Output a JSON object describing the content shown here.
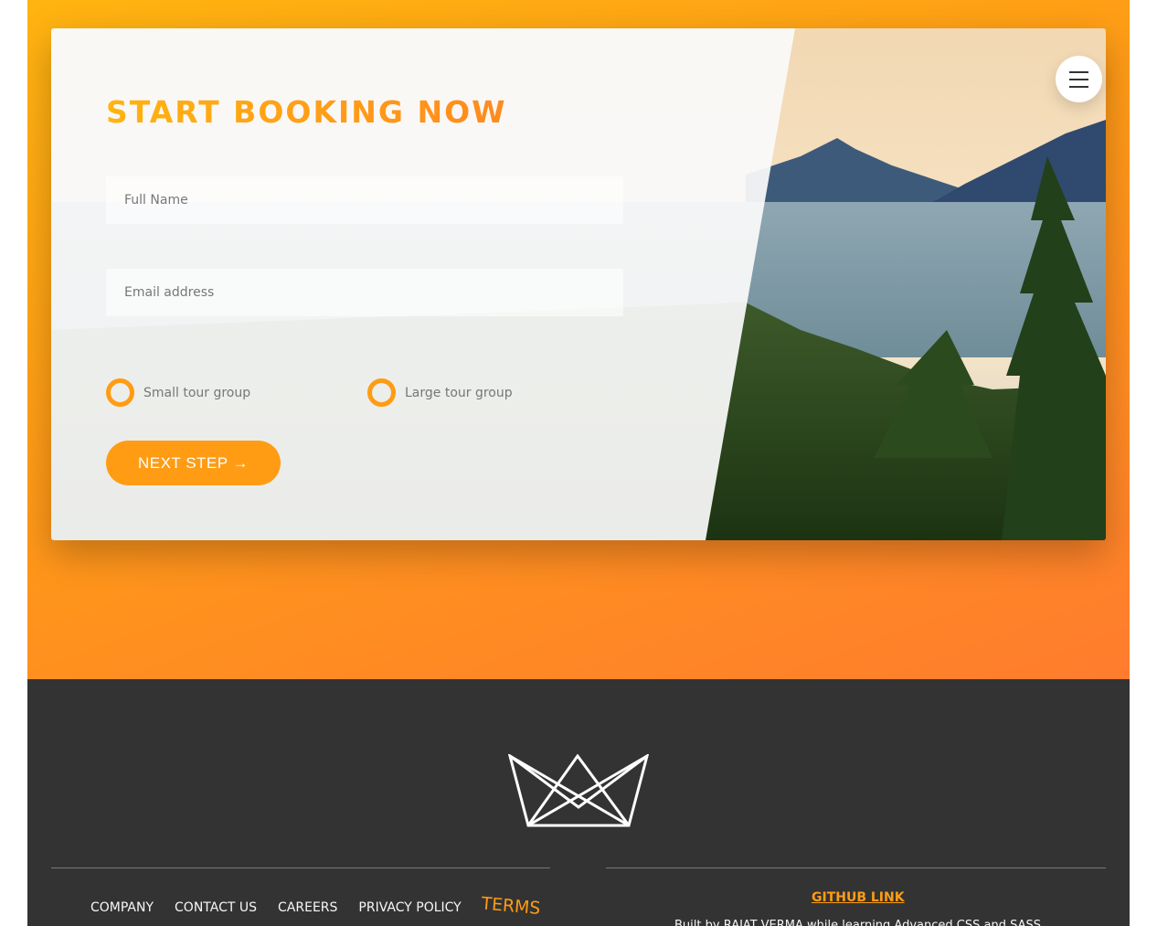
{
  "booking": {
    "title": "START BOOKING NOW",
    "full_name_placeholder": "Full Name",
    "email_placeholder": "Email address",
    "radio_small_label": "Small tour group",
    "radio_large_label": "Large tour group",
    "next_button_label": "NEXT STEP →"
  },
  "menu": {
    "icon": "hamburger-menu-icon"
  },
  "footer": {
    "logo_icon": "crown-logo-icon",
    "nav": [
      "COMPANY",
      "CONTACT US",
      "CAREERS",
      "PRIVACY POLICY",
      "TERMS"
    ],
    "github_link": "GITHUB LINK",
    "credit": "Built by RAJAT VERMA while learning Advanced CSS and SASS"
  },
  "colors": {
    "accent": "#ff9c14",
    "gradient_start": "#ffb410",
    "gradient_end": "#ff7c2e",
    "footer_bg": "#333333"
  }
}
